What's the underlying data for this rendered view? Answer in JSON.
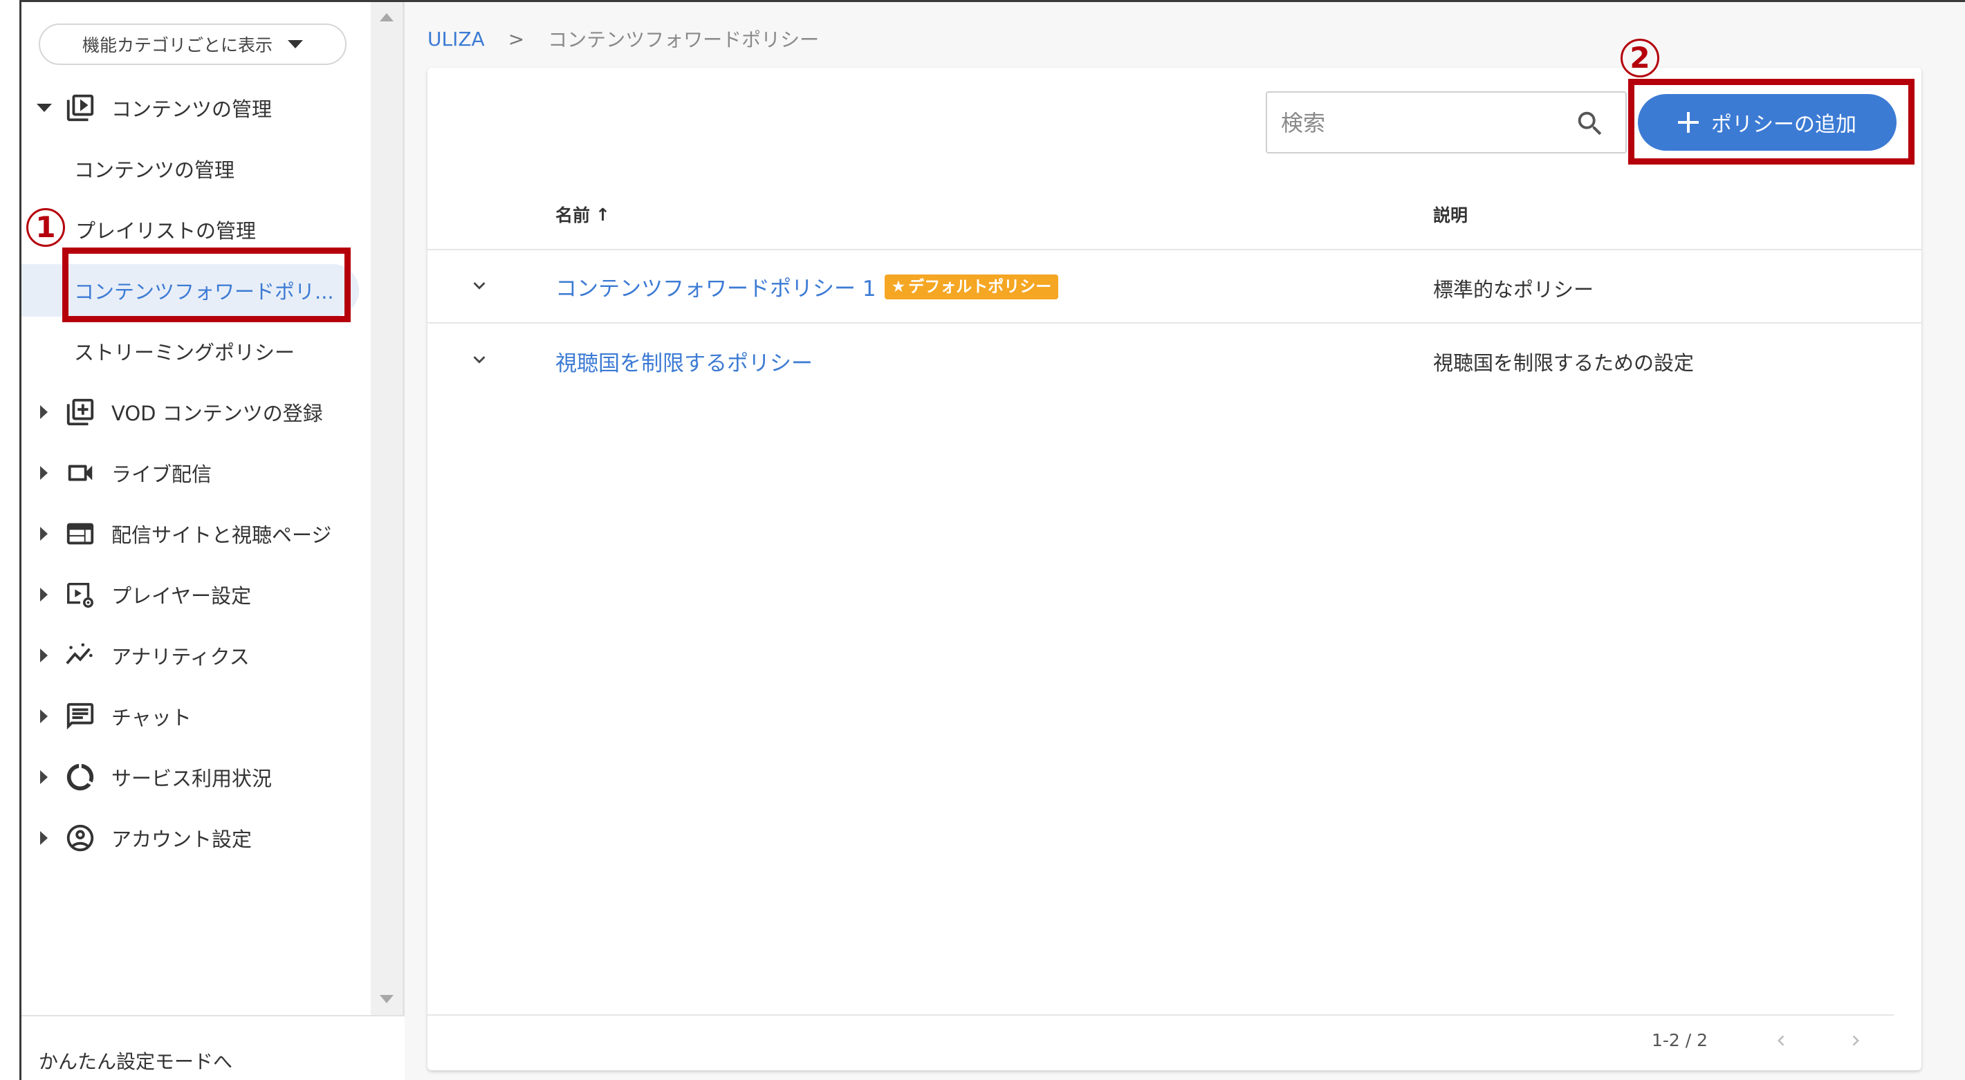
{
  "sidebar": {
    "category_select_label": "機能カテゴリごとに表示",
    "sections": [
      {
        "label": "コンテンツの管理",
        "icon": "play-library-icon",
        "expanded": true
      },
      {
        "label": "VOD コンテンツの登録",
        "icon": "library-add-icon",
        "expanded": false
      },
      {
        "label": "ライブ配信",
        "icon": "videocam-icon",
        "expanded": false
      },
      {
        "label": "配信サイトと視聴ページ",
        "icon": "web-layout-icon",
        "expanded": false
      },
      {
        "label": "プレイヤー設定",
        "icon": "player-settings-icon",
        "expanded": false
      },
      {
        "label": "アナリティクス",
        "icon": "analytics-icon",
        "expanded": false
      },
      {
        "label": "チャット",
        "icon": "chat-icon",
        "expanded": false
      },
      {
        "label": "サービス利用状況",
        "icon": "usage-donut-icon",
        "expanded": false
      },
      {
        "label": "アカウント設定",
        "icon": "account-icon",
        "expanded": false
      }
    ],
    "sub_items": [
      {
        "label": "コンテンツの管理"
      },
      {
        "label": "プレイリストの管理"
      },
      {
        "label": "コンテンツフォワードポリ..."
      },
      {
        "label": "ストリーミングポリシー"
      }
    ],
    "easy_mode_label": "かんたん設定モードへ"
  },
  "annotations": {
    "marker_1": "1",
    "marker_2": "2",
    "marker_color": "#b5000c"
  },
  "breadcrumb": {
    "root": "ULIZA",
    "separator": ">",
    "current": "コンテンツフォワードポリシー"
  },
  "toolbar": {
    "search_placeholder": "検索",
    "add_button_label": "ポリシーの追加"
  },
  "table": {
    "columns": {
      "name": "名前",
      "sort_arrow": "↑",
      "description": "説明"
    },
    "rows": [
      {
        "name": "コンテンツフォワードポリシー 1",
        "badge": "デフォルトポリシー",
        "badge_star": "★",
        "description": "標準的なポリシー"
      },
      {
        "name": "視聴国を制限するポリシー",
        "badge": "",
        "description": "視聴国を制限するための設定"
      }
    ]
  },
  "pagination": {
    "range": "1-2 / 2"
  },
  "colors": {
    "accent": "#3c7bd4",
    "badge": "#f5a623",
    "active_bg": "#e8eef8"
  }
}
